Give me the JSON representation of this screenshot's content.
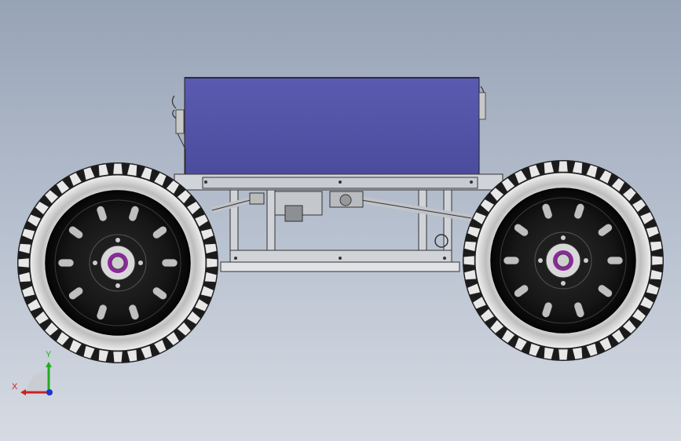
{
  "viewport": {
    "background_top": "#97a3b6",
    "background_bottom": "#d6dbe3"
  },
  "model": {
    "body_color": "#5252a6",
    "frame_color": "#d0d3d8",
    "tire_color": "#1a1a1a",
    "rim_color": "#111111",
    "hub_accent_color": "#8a2a9a",
    "wheel_count": 2
  },
  "triad": {
    "x_label": "X",
    "y_label": "Y",
    "x_color": "#cc2222",
    "y_color": "#22aa22",
    "z_color": "#2233cc"
  }
}
